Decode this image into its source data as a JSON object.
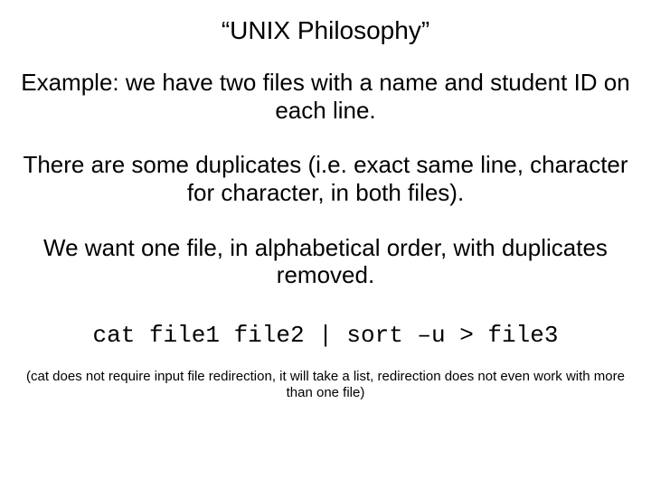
{
  "slide": {
    "title": "“UNIX Philosophy”",
    "p1": "Example: we have two files with a name and student ID on each line.",
    "p2": "There are some duplicates (i.e. exact same line, character for character, in both files).",
    "p3": "We want one file, in alphabetical order, with duplicates removed.",
    "command": "cat file1 file2 | sort –u > file3",
    "footnote": "(cat does not require input file redirection, it will take a list, redirection does not even work with more than one file)"
  }
}
